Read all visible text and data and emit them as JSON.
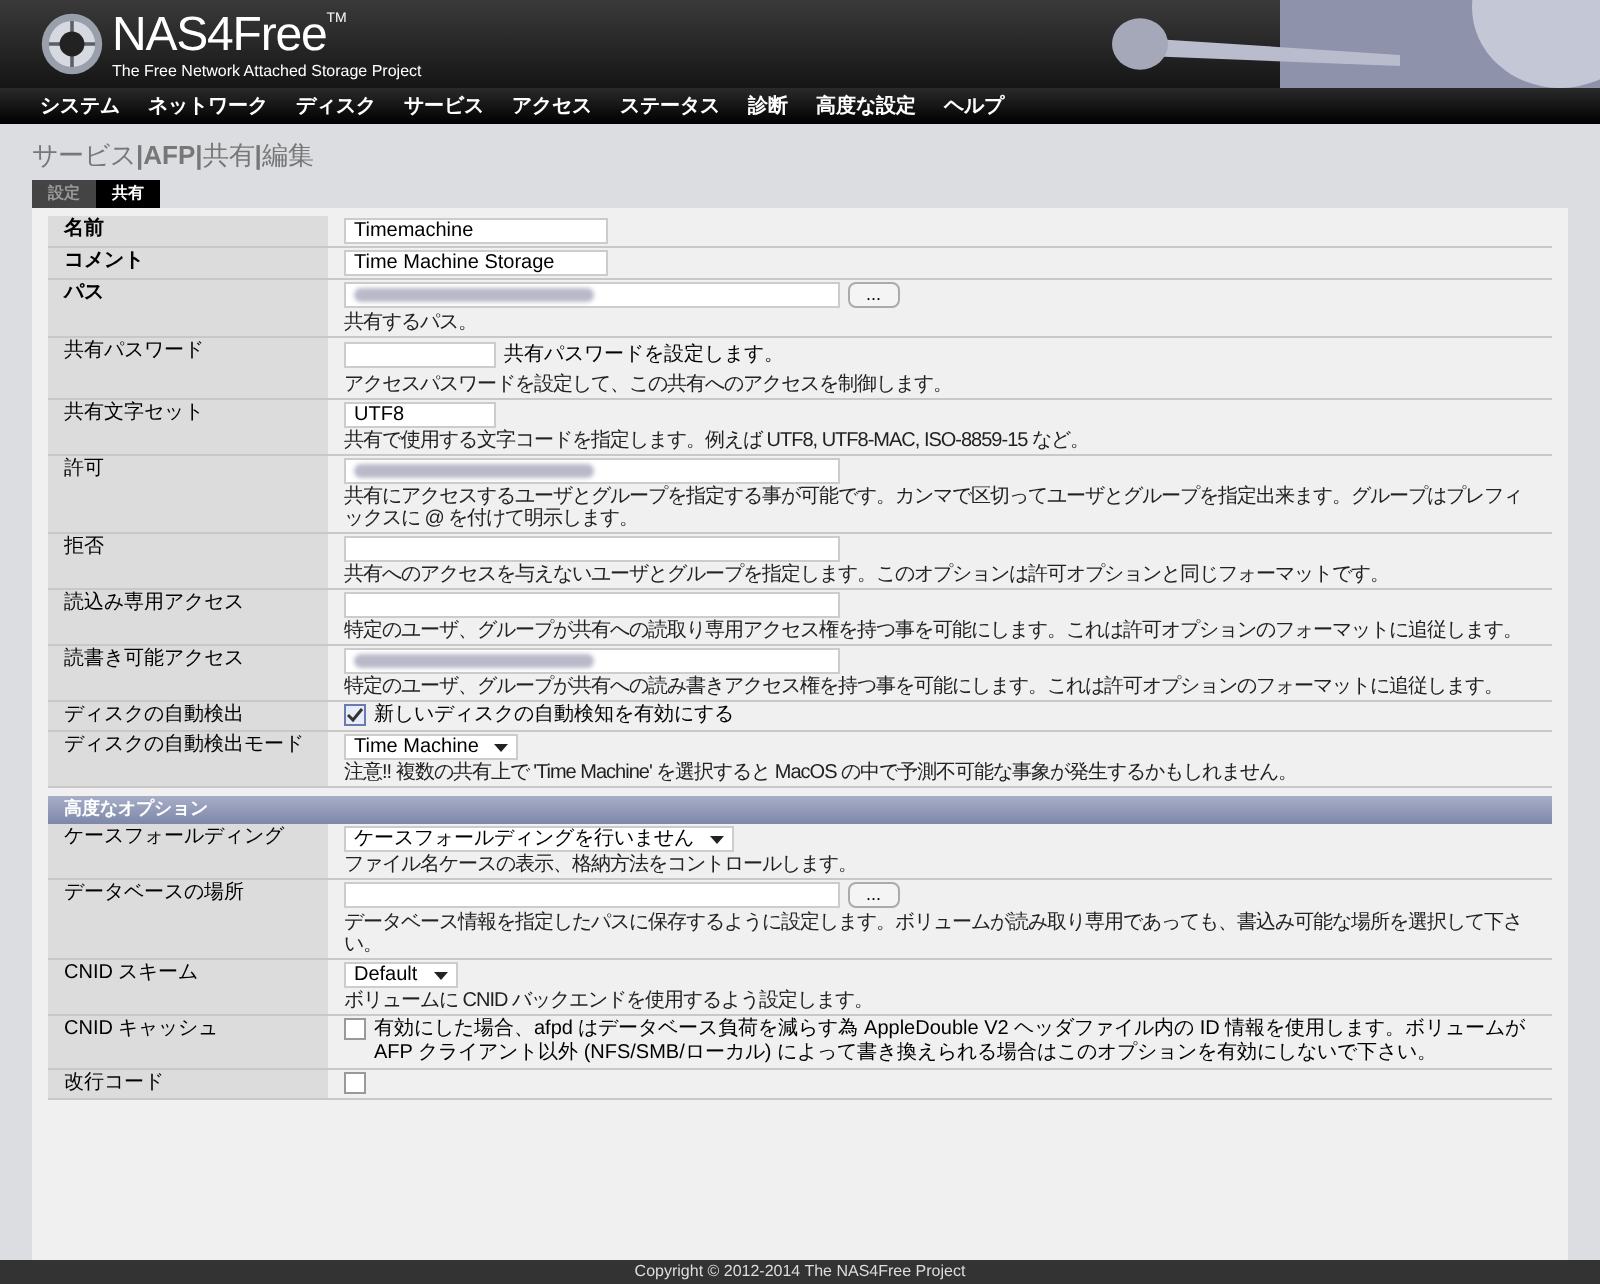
{
  "logo": {
    "name": "NAS4Free",
    "trademark": "TM",
    "tagline": "The Free Network Attached Storage Project"
  },
  "nav": [
    "システム",
    "ネットワーク",
    "ディスク",
    "サービス",
    "アクセス",
    "ステータス",
    "診断",
    "高度な設定",
    "ヘルプ"
  ],
  "breadcrumb": "サービス**|AFP|**共有**|**編集",
  "tabs": [
    {
      "label": "設定",
      "selected": false
    },
    {
      "label": "共有",
      "selected": true
    }
  ],
  "rows": [
    {
      "kind": "text",
      "label": "名前",
      "required": true,
      "value": "Timemachine"
    },
    {
      "kind": "text",
      "label": "コメント",
      "required": true,
      "value": "Time Machine Storage"
    },
    {
      "kind": "path",
      "label": "パス",
      "required": true,
      "blurred": true,
      "button": "...",
      "description": "共有するパス。"
    },
    {
      "kind": "password",
      "label": "共有パスワード",
      "required": false,
      "inline": "共有パスワードを設定します。",
      "description": "アクセスパスワードを設定して、この共有へのアクセスを制御します。"
    },
    {
      "kind": "short",
      "label": "共有文字セット",
      "required": false,
      "value": "UTF8",
      "description": "共有で使用する文字コードを指定します。例えば UTF8, UTF8-MAC, ISO-8859-15 など。"
    },
    {
      "kind": "wide",
      "label": "許可",
      "required": false,
      "blurred": true,
      "description": "共有にアクセスするユーザとグループを指定する事が可能です。カンマで区切ってユーザとグループを指定出来ます。グループはプレフィックスに @ を付けて明示します。"
    },
    {
      "kind": "wide",
      "label": "拒否",
      "required": false,
      "blurred": false,
      "description": "共有へのアクセスを与えないユーザとグループを指定します。このオプションは許可オプションと同じフォーマットです。"
    },
    {
      "kind": "wide",
      "label": "読込み専用アクセス",
      "required": false,
      "blurred": false,
      "description": "特定のユーザ、グループが共有への読取り専用アクセス権を持つ事を可能にします。これは許可オプションのフォーマットに追従します。"
    },
    {
      "kind": "wide",
      "label": "読書き可能アクセス",
      "required": false,
      "blurred": true,
      "description": "特定のユーザ、グループが共有への読み書きアクセス権を持つ事を可能にします。これは許可オプションのフォーマットに追従します。"
    },
    {
      "kind": "checkbox",
      "label": "ディスクの自動検出",
      "required": false,
      "checked": true,
      "text": "新しいディスクの自動検知を有効にする"
    },
    {
      "kind": "select",
      "label": "ディスクの自動検出モード",
      "required": false,
      "value": "Time Machine",
      "description": "注意!! 複数の共有上で 'Time Machine' を選択すると MacOS の中で予測不可能な事象が発生するかもしれません。"
    },
    {
      "kind": "section",
      "label": "高度なオプション"
    },
    {
      "kind": "select",
      "label": "ケースフォールディング",
      "required": false,
      "value": "ケースフォールディングを行いません",
      "description": "ファイル名ケースの表示、格納方法をコントロールします。"
    },
    {
      "kind": "path",
      "label": "データベースの場所",
      "required": false,
      "blurred": false,
      "button": "...",
      "description": "データベース情報を指定したパスに保存するように設定します。ボリュームが読み取り専用であっても、書込み可能な場所を選択して下さい。"
    },
    {
      "kind": "select",
      "label": "CNID スキーム",
      "required": false,
      "value": "Default",
      "description": "ボリュームに CNID バックエンドを使用するよう設定します。"
    },
    {
      "kind": "checkbox",
      "label": "CNID キャッシュ",
      "required": false,
      "checked": false,
      "text": "有効にした場合、afpd はデータベース負荷を減らす為 AppleDouble V2 ヘッダファイル内の ID 情報を使用します。ボリュームが AFP クライアント以外 (NFS/SMB/ローカル) によって書き換えられる場合はこのオプションを有効にしないで下さい。"
    },
    {
      "kind": "checkbox",
      "label": "改行コード",
      "required": false,
      "checked": false
    }
  ],
  "footer": "Copyright © 2012-2014 The NAS4Free Project"
}
